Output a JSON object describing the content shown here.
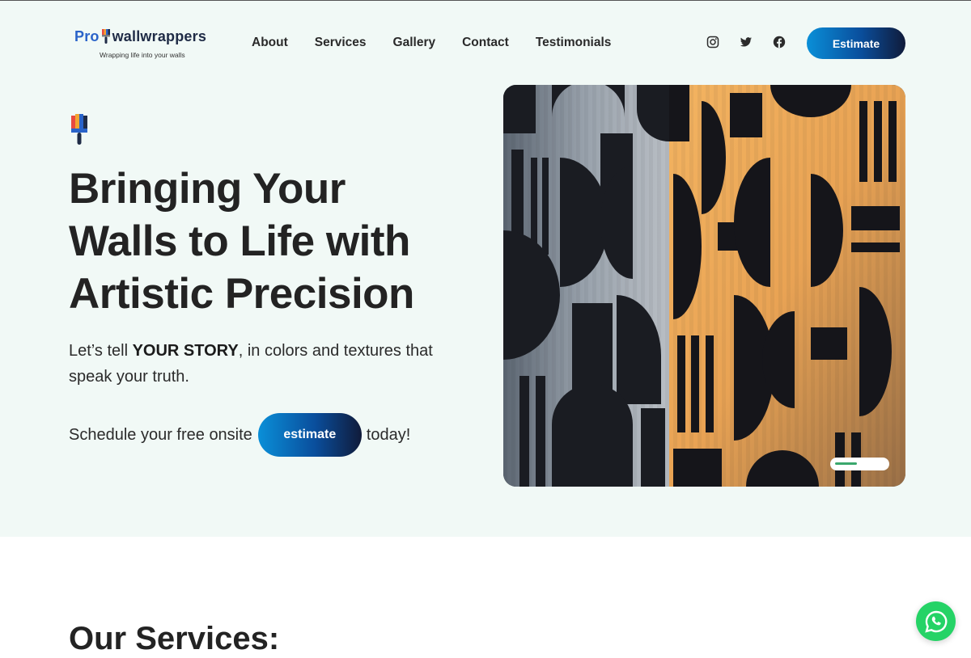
{
  "logo": {
    "part1": "Pro",
    "part2": "wallwrappers",
    "tagline": "Wrapping life into your walls"
  },
  "nav": {
    "items": [
      "About",
      "Services",
      "Gallery",
      "Contact",
      "Testimonials"
    ]
  },
  "social": {
    "icons": [
      "instagram-icon",
      "twitter-icon",
      "facebook-icon"
    ]
  },
  "header": {
    "estimate_label": "Estimate"
  },
  "hero": {
    "title_line1": "Bringing Your",
    "title_line2": "Walls to Life with",
    "title_line3": "Artistic Precision",
    "sub_pre": "Let’s tell ",
    "sub_bold": "YOUR STORY",
    "sub_post": ", in colors and textures that speak your truth.",
    "cta_pre": "Schedule your free onsite",
    "cta_button": "estimate",
    "cta_post": "today!",
    "slider_progress": 0.45
  },
  "services": {
    "title": "Our Services:"
  },
  "colors": {
    "hero_bg": "#f1f9f6",
    "accent_start": "#0a8fd8",
    "accent_end": "#101b3a",
    "whatsapp": "#25d366",
    "slider": "#3aa76d"
  }
}
